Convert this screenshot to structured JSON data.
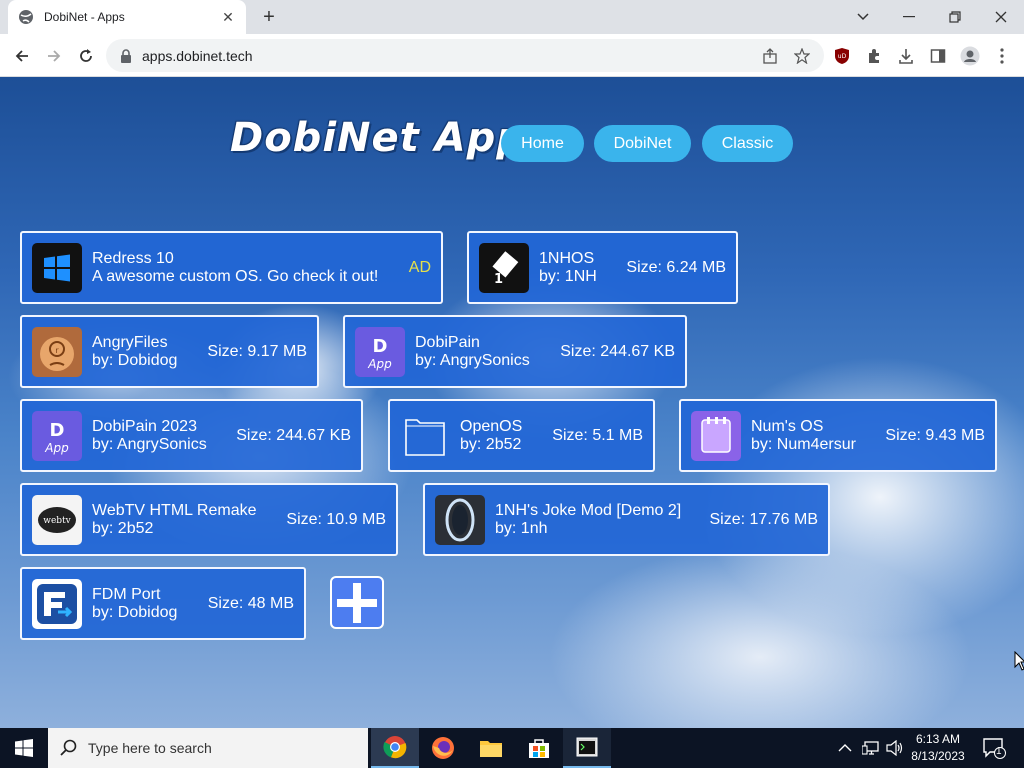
{
  "browser": {
    "tab_title": "DobiNet - Apps",
    "url": "apps.dobinet.tech"
  },
  "page": {
    "logo": "DobiNet Apps",
    "nav": [
      "Home",
      "DobiNet",
      "Classic"
    ],
    "apps": [
      {
        "name": "Redress 10",
        "line2": "A awesome custom OS. Go check it out!",
        "meta": "AD",
        "icon": "windows-icon"
      },
      {
        "name": "1NHOS",
        "line2": "by: 1NH",
        "meta": "Size: 6.24 MB",
        "icon": "1nhos-icon"
      },
      {
        "name": "AngryFiles",
        "line2": "by: Dobidog",
        "meta": "Size: 9.17 MB",
        "icon": "angryfiles-icon"
      },
      {
        "name": "DobiPain",
        "line2": "by: AngrySonics",
        "meta": "Size: 244.67 KB",
        "icon": "dobipain-icon"
      },
      {
        "name": "DobiPain 2023",
        "line2": "by: AngrySonics",
        "meta": "Size: 244.67 KB",
        "icon": "dobipain-icon"
      },
      {
        "name": "OpenOS",
        "line2": "by: 2b52",
        "meta": "Size: 5.1 MB",
        "icon": "folder-icon"
      },
      {
        "name": "Num's OS",
        "line2": "by: Num4ersur",
        "meta": "Size: 9.43 MB",
        "icon": "numsos-icon"
      },
      {
        "name": "WebTV HTML Remake",
        "line2": "by: 2b52",
        "meta": "Size: 10.9 MB",
        "icon": "webtv-icon"
      },
      {
        "name": "1NH's Joke Mod [Demo 2]",
        "line2": "by: 1nh",
        "meta": "Size: 17.76 MB",
        "icon": "portal-icon"
      },
      {
        "name": "FDM Port",
        "line2": "by: Dobidog",
        "meta": "Size: 48 MB",
        "icon": "fdm-icon"
      }
    ]
  },
  "taskbar": {
    "search_placeholder": "Type here to search",
    "time": "6:13 AM",
    "date": "8/13/2023",
    "notifications": "1"
  },
  "colors": {
    "card_bg": "#2266d6",
    "pill_bg": "#3ab4ec",
    "ad_text": "#e6e04a"
  }
}
